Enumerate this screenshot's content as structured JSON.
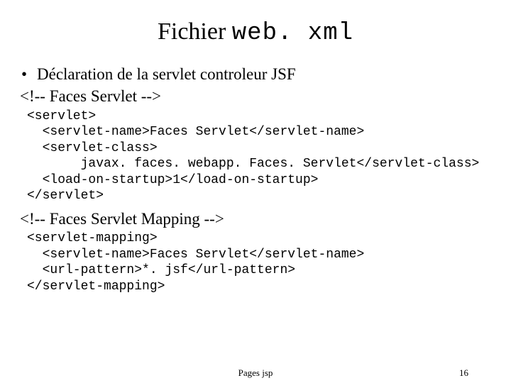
{
  "title": {
    "prefix": "Fichier ",
    "mono": "web. xml"
  },
  "bullet1": "Déclaration de la servlet controleur JSF",
  "comment1": "<!-- Faces Servlet -->",
  "code1": "<servlet>\n  <servlet-name>Faces Servlet</servlet-name>\n  <servlet-class>\n       javax. faces. webapp. Faces. Servlet</servlet-class>\n  <load-on-startup>1</load-on-startup>\n</servlet>",
  "comment2": "<!-- Faces Servlet Mapping -->",
  "code2": "<servlet-mapping>\n  <servlet-name>Faces Servlet</servlet-name>\n  <url-pattern>*. jsf</url-pattern>\n</servlet-mapping>",
  "footer": {
    "center": "Pages jsp",
    "page": "16"
  }
}
